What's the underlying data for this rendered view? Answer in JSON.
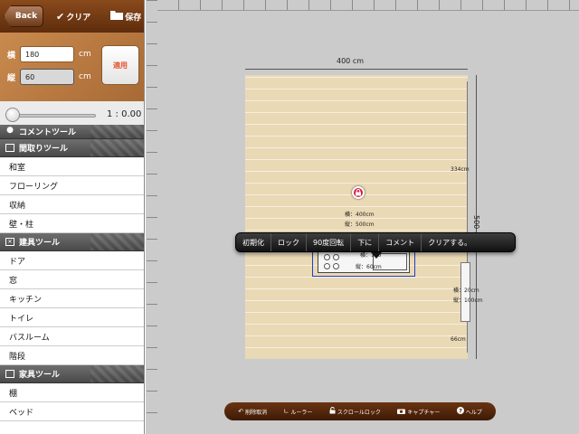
{
  "toolbar": {
    "back_label": "Back",
    "clear_label": "クリア",
    "save_label": "保存"
  },
  "size_panel": {
    "width_label": "横",
    "width_value": "180",
    "depth_label": "縦",
    "depth_value": "60",
    "unit": "cm",
    "apply_label": "適用"
  },
  "scale": {
    "text": "1 : 0.00"
  },
  "tool_list": {
    "comment_tool": "コメントツール",
    "layout_tool": "間取りツール",
    "layout_items": [
      "和室",
      "フローリング",
      "収納",
      "壁・柱"
    ],
    "fixture_tool": "建具ツール",
    "fixture_items": [
      "ドア",
      "窓",
      "キッチン",
      "トイレ",
      "バスルーム",
      "階段"
    ],
    "furniture_tool": "家具ツール",
    "furniture_items": [
      "棚",
      "ベッド"
    ]
  },
  "canvas": {
    "room_width_label": "400 cm",
    "room_depth_label": "500",
    "right_segment_top": "334cm",
    "right_segment_bottom": "66cm",
    "room_dims": {
      "width": "横：400cm",
      "depth": "縦：500cm"
    },
    "furniture_dims": {
      "width_partial": "横：180",
      "depth": "縦：60cm"
    },
    "wall_item_dims": {
      "width": "横：20cm",
      "depth": "縦：100cm"
    }
  },
  "context_menu": {
    "items": [
      "初期化",
      "ロック",
      "90度回転",
      "下に",
      "コメント",
      "クリアする。"
    ]
  },
  "bottom_bar": {
    "undo": "削除取消",
    "ruler": "ルーラー",
    "scroll_lock": "スクロールロック",
    "capture": "キャプチャー",
    "help": "ヘルプ"
  },
  "colors": {
    "toolbar_brown": "#5e2c0c",
    "panel_orange": "#c98a4e",
    "apply_text": "#e3542d",
    "room_floor": "#ead9b5",
    "selection_blue": "#1e3fcc",
    "lock_red": "#d51d3e"
  },
  "icons": {
    "clear": "checkmark-icon",
    "save": "folder-icon",
    "lock": "lock-icon",
    "undo": "undo-icon",
    "ruler": "ruler-icon",
    "scroll_lock": "padlock-icon",
    "capture": "camera-icon",
    "help": "help-icon"
  }
}
